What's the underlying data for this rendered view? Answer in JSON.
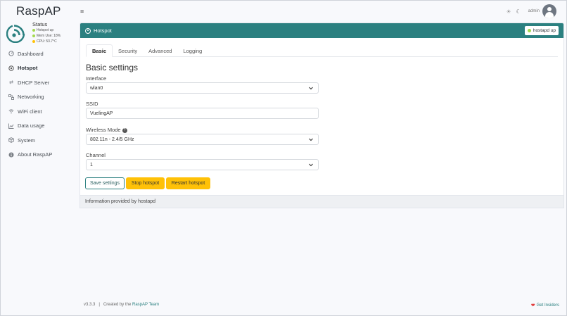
{
  "brand": {
    "name": "RaspAP"
  },
  "status": {
    "title": "Status",
    "items": [
      {
        "text": "Hotspot up",
        "color": "#a3d94c"
      },
      {
        "text": "Mem Use: 18%",
        "color": "#a3d94c"
      },
      {
        "text": "CPU: 53.7°C",
        "color": "#ffc107"
      }
    ]
  },
  "nav": {
    "items": [
      {
        "label": "Dashboard",
        "icon": "gauge-icon"
      },
      {
        "label": "Hotspot",
        "icon": "hotspot-icon"
      },
      {
        "label": "DHCP Server",
        "icon": "exchange-icon"
      },
      {
        "label": "Networking",
        "icon": "network-icon"
      },
      {
        "label": "WiFi client",
        "icon": "wifi-icon"
      },
      {
        "label": "Data usage",
        "icon": "chart-icon"
      },
      {
        "label": "System",
        "icon": "cube-icon"
      },
      {
        "label": "About RaspAP",
        "icon": "info-icon"
      }
    ],
    "active": "Hotspot"
  },
  "topbar": {
    "user": "admin"
  },
  "card": {
    "title": "Hotspot",
    "badge": "hostapd up",
    "tabs": [
      "Basic",
      "Security",
      "Advanced",
      "Logging"
    ],
    "section_title": "Basic settings",
    "fields": {
      "interface": {
        "label": "Interface",
        "value": "wlan0"
      },
      "ssid": {
        "label": "SSID",
        "value": "VuelingAP"
      },
      "wireless_mode": {
        "label": "Wireless Mode",
        "value": "802.11n - 2.4/5 GHz"
      },
      "channel": {
        "label": "Channel",
        "value": "1"
      }
    },
    "buttons": {
      "save": "Save settings",
      "stop": "Stop hotspot",
      "restart": "Restart hotspot"
    },
    "footer": "Information provided by hostapd"
  },
  "footer": {
    "version": "v3.3.3",
    "separator": "|",
    "created_prefix": "Created by the",
    "team": "RaspAP Team",
    "insiders": "Get Insiders"
  },
  "colors": {
    "accent": "#2b8080",
    "warning": "#ffc107",
    "success": "#a3d94c"
  }
}
